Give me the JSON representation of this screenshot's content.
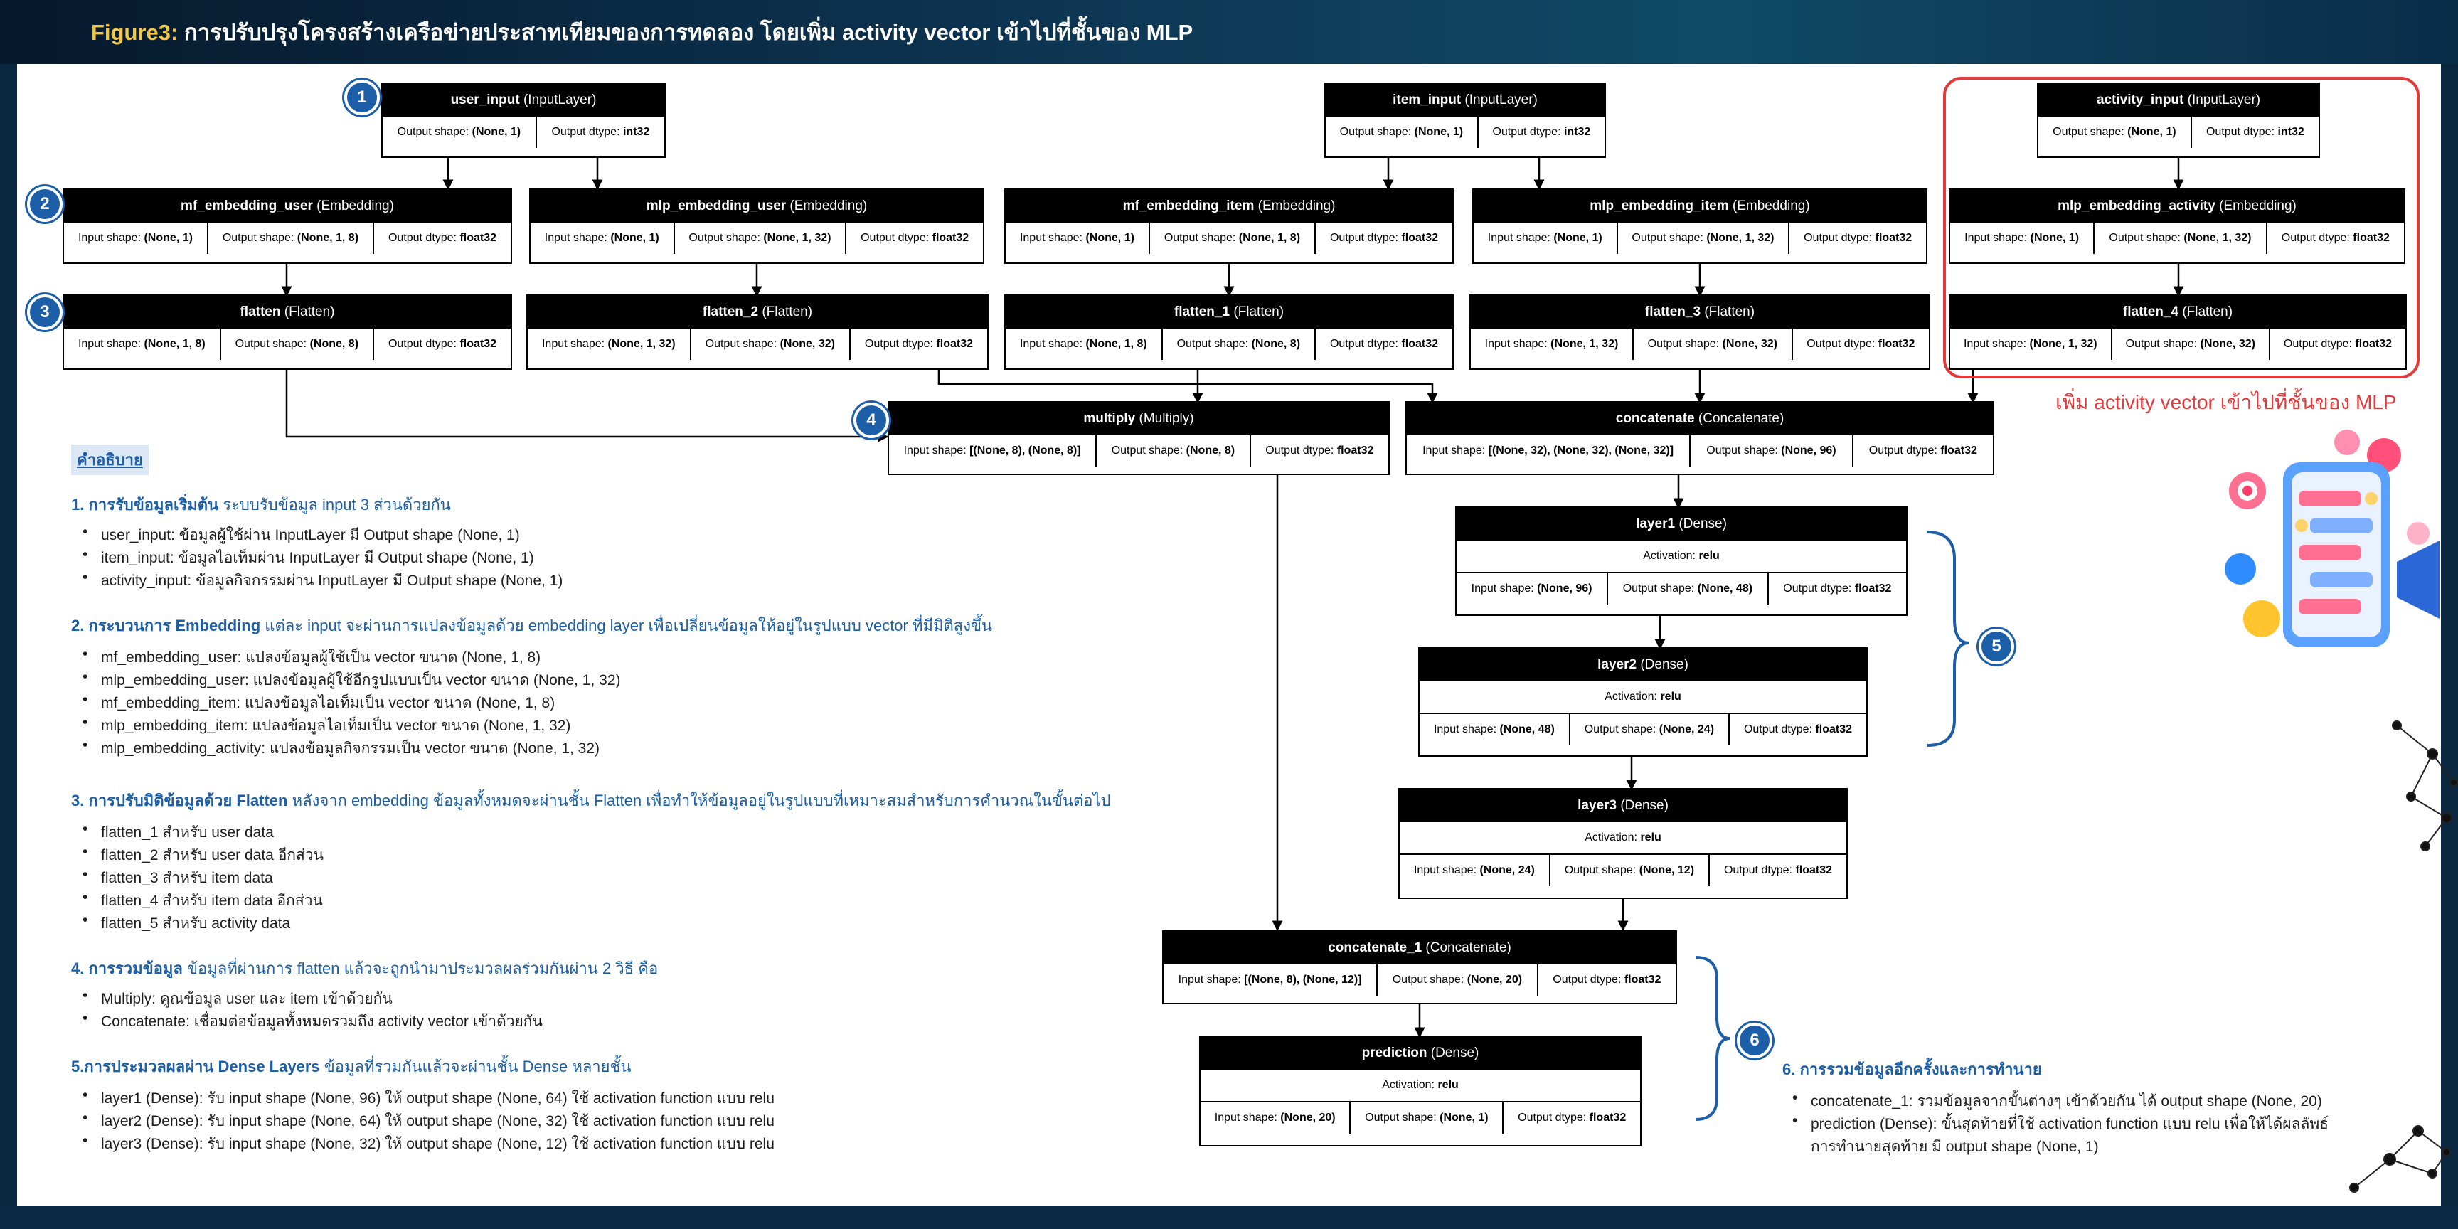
{
  "banner": {
    "figure_label": "Figure3:",
    "title": " การปรับปรุงโครงสร้างเครือข่ายประสาทเทียมของการทดลอง โดยเพิ่ม activity vector เข้าไปที่ชั้นของ MLP"
  },
  "badges": [
    "1",
    "2",
    "3",
    "4",
    "5",
    "6"
  ],
  "highlight_caption": "เพิ่ม activity vector เข้าไปที่ชั้นของ MLP",
  "nodes": {
    "user_input": {
      "name": "user_input",
      "type": " (InputLayer)",
      "cells": [
        [
          "Output shape: ",
          "(None, 1)"
        ],
        [
          "Output dtype: ",
          "int32"
        ]
      ]
    },
    "item_input": {
      "name": "item_input",
      "type": " (InputLayer)",
      "cells": [
        [
          "Output shape: ",
          "(None, 1)"
        ],
        [
          "Output dtype: ",
          "int32"
        ]
      ]
    },
    "activity_input": {
      "name": "activity_input",
      "type": " (InputLayer)",
      "cells": [
        [
          "Output shape: ",
          "(None, 1)"
        ],
        [
          "Output dtype: ",
          "int32"
        ]
      ]
    },
    "mf_embedding_user": {
      "name": "mf_embedding_user",
      "type": " (Embedding)",
      "cells": [
        [
          "Input shape: ",
          "(None, 1)"
        ],
        [
          "Output shape: ",
          "(None, 1, 8)"
        ],
        [
          "Output dtype: ",
          "float32"
        ]
      ]
    },
    "mlp_embedding_user": {
      "name": "mlp_embedding_user",
      "type": " (Embedding)",
      "cells": [
        [
          "Input shape: ",
          "(None, 1)"
        ],
        [
          "Output shape: ",
          "(None, 1, 32)"
        ],
        [
          "Output dtype: ",
          "float32"
        ]
      ]
    },
    "mf_embedding_item": {
      "name": "mf_embedding_item",
      "type": " (Embedding)",
      "cells": [
        [
          "Input shape: ",
          "(None, 1)"
        ],
        [
          "Output shape: ",
          "(None, 1, 8)"
        ],
        [
          "Output dtype: ",
          "float32"
        ]
      ]
    },
    "mlp_embedding_item": {
      "name": "mlp_embedding_item",
      "type": " (Embedding)",
      "cells": [
        [
          "Input shape: ",
          "(None, 1)"
        ],
        [
          "Output shape: ",
          "(None, 1, 32)"
        ],
        [
          "Output dtype: ",
          "float32"
        ]
      ]
    },
    "mlp_embedding_activity": {
      "name": "mlp_embedding_activity",
      "type": " (Embedding)",
      "cells": [
        [
          "Input shape: ",
          "(None, 1)"
        ],
        [
          "Output shape: ",
          "(None, 1, 32)"
        ],
        [
          "Output dtype: ",
          "float32"
        ]
      ]
    },
    "flatten": {
      "name": "flatten",
      "type": " (Flatten)",
      "cells": [
        [
          "Input shape: ",
          "(None, 1, 8)"
        ],
        [
          "Output shape: ",
          "(None, 8)"
        ],
        [
          "Output dtype: ",
          "float32"
        ]
      ]
    },
    "flatten_2": {
      "name": "flatten_2",
      "type": " (Flatten)",
      "cells": [
        [
          "Input shape: ",
          "(None, 1, 32)"
        ],
        [
          "Output shape: ",
          "(None, 32)"
        ],
        [
          "Output dtype: ",
          "float32"
        ]
      ]
    },
    "flatten_1": {
      "name": "flatten_1",
      "type": " (Flatten)",
      "cells": [
        [
          "Input shape: ",
          "(None, 1, 8)"
        ],
        [
          "Output shape: ",
          "(None, 8)"
        ],
        [
          "Output dtype: ",
          "float32"
        ]
      ]
    },
    "flatten_3": {
      "name": "flatten_3",
      "type": " (Flatten)",
      "cells": [
        [
          "Input shape: ",
          "(None, 1, 32)"
        ],
        [
          "Output shape: ",
          "(None, 32)"
        ],
        [
          "Output dtype: ",
          "float32"
        ]
      ]
    },
    "flatten_4": {
      "name": "flatten_4",
      "type": " (Flatten)",
      "cells": [
        [
          "Input shape: ",
          "(None, 1, 32)"
        ],
        [
          "Output shape: ",
          "(None, 32)"
        ],
        [
          "Output dtype: ",
          "float32"
        ]
      ]
    },
    "multiply": {
      "name": "multiply",
      "type": " (Multiply)",
      "cells": [
        [
          "Input shape: ",
          "[(None, 8), (None, 8)]"
        ],
        [
          "Output shape: ",
          "(None, 8)"
        ],
        [
          "Output dtype: ",
          "float32"
        ]
      ]
    },
    "concatenate": {
      "name": "concatenate",
      "type": " (Concatenate)",
      "cells": [
        [
          "Input shape: ",
          "[(None, 32), (None, 32), (None, 32)]"
        ],
        [
          "Output shape: ",
          "(None, 96)"
        ],
        [
          "Output dtype: ",
          "float32"
        ]
      ]
    },
    "layer1": {
      "name": "layer1",
      "type": " (Dense)",
      "activation": [
        "Activation: ",
        "relu"
      ],
      "cells": [
        [
          "Input shape: ",
          "(None, 96)"
        ],
        [
          "Output shape: ",
          "(None, 48)"
        ],
        [
          "Output dtype: ",
          "float32"
        ]
      ]
    },
    "layer2": {
      "name": "layer2",
      "type": " (Dense)",
      "activation": [
        "Activation: ",
        "relu"
      ],
      "cells": [
        [
          "Input shape: ",
          "(None, 48)"
        ],
        [
          "Output shape: ",
          "(None, 24)"
        ],
        [
          "Output dtype: ",
          "float32"
        ]
      ]
    },
    "layer3": {
      "name": "layer3",
      "type": " (Dense)",
      "activation": [
        "Activation: ",
        "relu"
      ],
      "cells": [
        [
          "Input shape: ",
          "(None, 24)"
        ],
        [
          "Output shape: ",
          "(None, 12)"
        ],
        [
          "Output dtype: ",
          "float32"
        ]
      ]
    },
    "concatenate_1": {
      "name": "concatenate_1",
      "type": " (Concatenate)",
      "cells": [
        [
          "Input shape: ",
          "[(None, 8), (None, 12)]"
        ],
        [
          "Output shape: ",
          "(None, 20)"
        ],
        [
          "Output dtype: ",
          "float32"
        ]
      ]
    },
    "prediction": {
      "name": "prediction",
      "type": " (Dense)",
      "activation": [
        "Activation: ",
        "relu"
      ],
      "cells": [
        [
          "Input shape: ",
          "(None, 20)"
        ],
        [
          "Output shape: ",
          "(None, 1)"
        ],
        [
          "Output dtype: ",
          "float32"
        ]
      ]
    }
  },
  "legend": {
    "label": "คำอธิบาย",
    "s1": {
      "head": "1. การรับข้อมูลเริ่มต้น",
      "desc": "  ระบบรับข้อมูล input 3 ส่วนด้วยกัน",
      "items": [
        "user_input: ข้อมูลผู้ใช้ผ่าน InputLayer มี Output shape (None, 1)",
        "item_input: ข้อมูลไอเท็มผ่าน InputLayer มี Output shape (None, 1)",
        "activity_input: ข้อมูลกิจกรรมผ่าน InputLayer มี Output shape (None, 1)"
      ]
    },
    "s2": {
      "head": "2. กระบวนการ Embedding",
      "desc": " แต่ละ input จะผ่านการแปลงข้อมูลด้วย embedding layer เพื่อเปลี่ยนข้อมูลให้อยู่ในรูปแบบ vector ที่มีมิติสูงขึ้น",
      "items": [
        "mf_embedding_user: แปลงข้อมูลผู้ใช้เป็น vector ขนาด (None, 1, 8)",
        "mlp_embedding_user: แปลงข้อมูลผู้ใช้อีกรูปแบบเป็น vector ขนาด (None, 1, 32)",
        "mf_embedding_item: แปลงข้อมูลไอเท็มเป็น vector ขนาด (None, 1, 8)",
        "mlp_embedding_item: แปลงข้อมูลไอเท็มเป็น vector ขนาด (None, 1, 32)",
        "mlp_embedding_activity: แปลงข้อมูลกิจกรรมเป็น vector ขนาด (None, 1, 32)"
      ]
    },
    "s3": {
      "head": "3. การปรับมิติข้อมูลด้วย Flatten",
      "desc": " หลังจาก embedding ข้อมูลทั้งหมดจะผ่านชั้น Flatten เพื่อทำให้ข้อมูลอยู่ในรูปแบบที่เหมาะสมสำหรับการคำนวณในขั้นต่อไป",
      "items": [
        "flatten_1 สำหรับ user data",
        "flatten_2 สำหรับ user data อีกส่วน",
        "flatten_3 สำหรับ item data",
        "flatten_4 สำหรับ item data อีกส่วน",
        "flatten_5 สำหรับ activity data"
      ]
    },
    "s4": {
      "head": "4. การรวมข้อมูล",
      "desc": " ข้อมูลที่ผ่านการ flatten แล้วจะถูกนำมาประมวลผลร่วมกันผ่าน 2 วิธี คือ",
      "items": [
        "Multiply: คูณข้อมูล user และ item เข้าด้วยกัน",
        "Concatenate: เชื่อมต่อข้อมูลทั้งหมดรวมถึง activity vector เข้าด้วยกัน"
      ]
    },
    "s5": {
      "head": "5.การประมวลผลผ่าน Dense Layers",
      "desc": " ข้อมูลที่รวมกันแล้วจะผ่านชั้น Dense หลายชั้น",
      "items": [
        "layer1 (Dense): รับ input shape (None, 96) ให้ output shape (None, 64) ใช้ activation function แบบ relu",
        "layer2 (Dense): รับ input shape (None, 64) ให้ output shape (None, 32) ใช้ activation function แบบ relu",
        "layer3 (Dense): รับ input shape (None, 32) ให้ output shape (None, 12) ใช้ activation function แบบ relu"
      ]
    },
    "s6": {
      "head": "6. การรวมข้อมูลอีกครั้งและการทำนาย",
      "items": [
        "concatenate_1: รวมข้อมูลจากขั้นต่างๆ เข้าด้วยกัน ได้ output shape (None, 20)",
        "prediction (Dense): ขั้นสุดท้ายที่ใช้ activation function แบบ relu เพื่อให้ได้ผลลัพธ์",
        "การทำนายสุดท้าย มี output shape (None, 1)"
      ]
    }
  },
  "colors": {
    "accent_blue": "#1c5fa8",
    "highlight_red": "#e23a3a",
    "figure_gold": "#f2c84b",
    "banner_navy": "#0d3350"
  }
}
